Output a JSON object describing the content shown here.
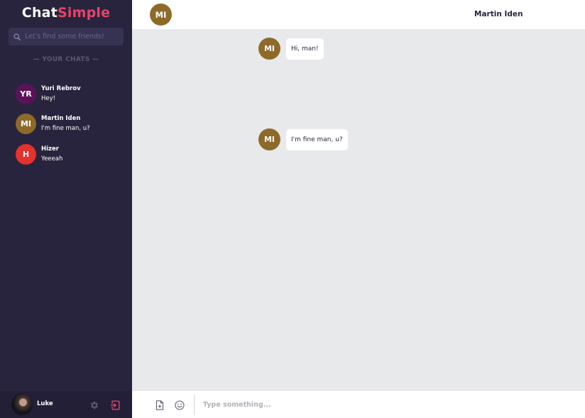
{
  "brand": {
    "part1": "Chat",
    "part2": "Simple"
  },
  "search": {
    "placeholder": "Let's find some friends!",
    "icon": "search-icon"
  },
  "sidebar": {
    "section_title": "— YOUR CHATS —",
    "chats": [
      {
        "initials": "YR",
        "name": "Yuri Rebrov",
        "last_message": "Hey!",
        "color": "#5b1259"
      },
      {
        "initials": "MI",
        "name": "Martin Iden",
        "last_message": "I'm fine man, u?",
        "color": "#8e6a2a"
      },
      {
        "initials": "H",
        "name": "Hizer",
        "last_message": "Yeeeah",
        "color": "#e5322d"
      }
    ]
  },
  "footer": {
    "user_name": "Luke",
    "settings_icon": "gear-icon",
    "logout_icon": "logout-icon"
  },
  "header": {
    "initials": "MI",
    "title": "Martin Iden",
    "color": "#8e6a2a"
  },
  "messages": [
    {
      "initials": "MI",
      "text": "Hi, man!",
      "color": "#8e6a2a"
    },
    {
      "initials": "MI",
      "text": "I'm fine man, u?",
      "color": "#8e6a2a"
    }
  ],
  "composer": {
    "placeholder": "Type something...",
    "attach_icon": "file-plus-icon",
    "emoji_icon": "smiley-icon"
  },
  "colors": {
    "sidebar_bg": "#28243d",
    "accent": "#e8436a",
    "chat_bg": "#e8e9eb"
  }
}
